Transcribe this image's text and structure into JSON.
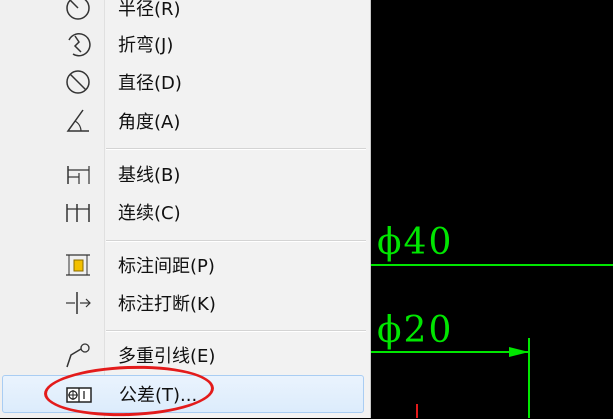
{
  "menu": {
    "items": [
      {
        "label": "半径(R)",
        "icon": "radius-icon"
      },
      {
        "label": "折弯(J)",
        "icon": "jogged-icon"
      },
      {
        "label": "直径(D)",
        "icon": "diameter-icon"
      },
      {
        "label": "角度(A)",
        "icon": "angle-icon"
      },
      {
        "label": "基线(B)",
        "icon": "baseline-icon"
      },
      {
        "label": "连续(C)",
        "icon": "continue-icon"
      },
      {
        "label": "标注间距(P)",
        "icon": "dimension-space-icon"
      },
      {
        "label": "标注打断(K)",
        "icon": "dimension-break-icon"
      },
      {
        "label": "多重引线(E)",
        "icon": "multileader-icon"
      },
      {
        "label": "公差(T)...",
        "icon": "tolerance-icon"
      }
    ],
    "selected_label": "公差(T)..."
  },
  "canvas": {
    "dim1": "ϕ40",
    "dim2": "ϕ20",
    "line_color": "#00e600",
    "annotation_color": "#e31b1b"
  }
}
